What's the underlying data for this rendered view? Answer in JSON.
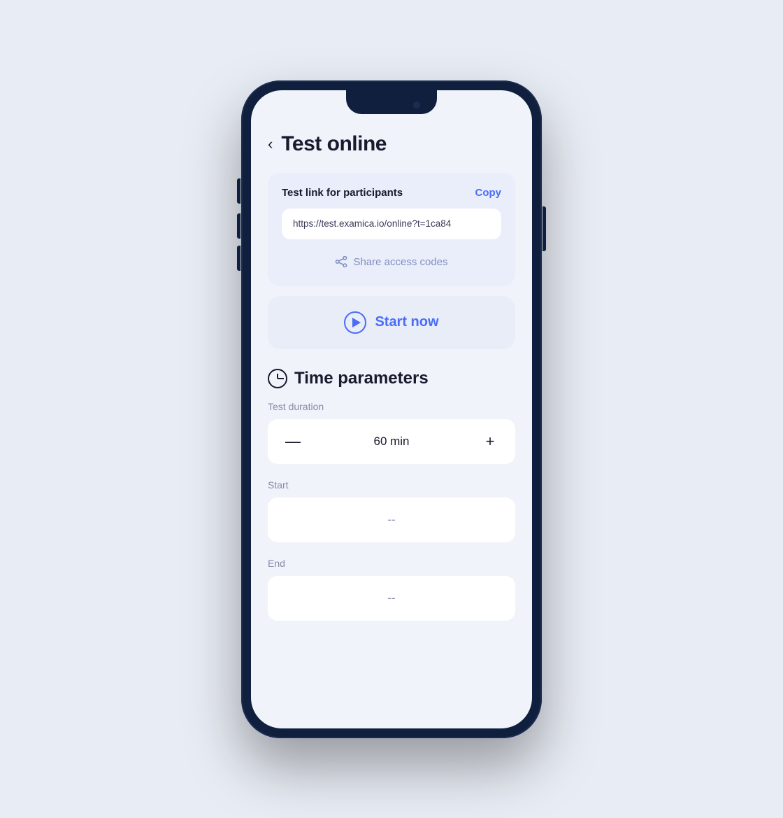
{
  "page": {
    "background": "#e8ecf4"
  },
  "header": {
    "back_label": "‹",
    "title": "Test online"
  },
  "test_link_card": {
    "label": "Test link for participants",
    "copy_label": "Copy",
    "link_url": "https://test.examica.io/online?t=1ca84",
    "share_label": "Share access codes"
  },
  "start_button": {
    "label": "Start now"
  },
  "time_parameters": {
    "section_title": "Time parameters",
    "duration_label": "Test duration",
    "duration_value": "60 min",
    "start_label": "Start",
    "start_value": "--",
    "end_label": "End",
    "end_value": "--"
  },
  "icons": {
    "back": "‹",
    "play": "▶",
    "clock": "⏱",
    "minus": "—",
    "plus": "+"
  }
}
